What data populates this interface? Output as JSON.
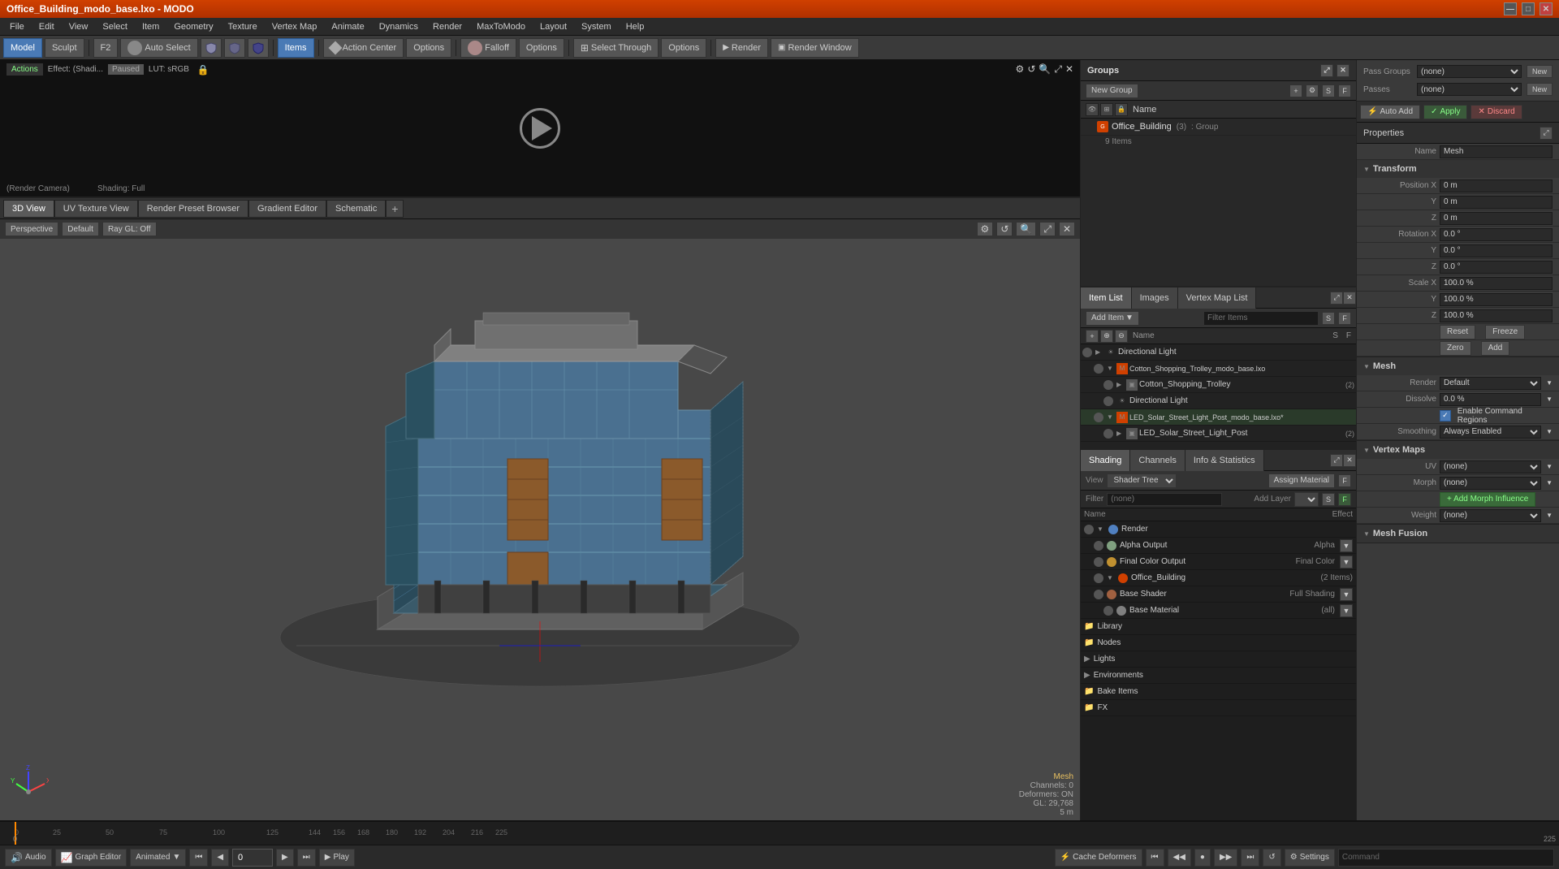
{
  "titleBar": {
    "title": "Office_Building_modo_base.lxo - MODO",
    "controls": [
      "—",
      "□",
      "✕"
    ]
  },
  "menuBar": {
    "items": [
      "File",
      "Edit",
      "View",
      "Select",
      "Item",
      "Geometry",
      "Texture",
      "Vertex Map",
      "Animate",
      "Dynamics",
      "Render",
      "MaxToModo",
      "Layout",
      "System",
      "Help"
    ]
  },
  "toolbar": {
    "modeButtons": [
      "Model",
      "Sculpt"
    ],
    "f2": "F2",
    "autoSelect": "Auto Select",
    "items": "Items",
    "actionCenter": "Action Center",
    "options1": "Options",
    "falloff": "Falloff",
    "options2": "Options",
    "selectThrough": "Select Through",
    "options3": "Options",
    "render": "Render",
    "renderWindow": "Render Window"
  },
  "previewStrip": {
    "label": "Actions",
    "effect": "Effect: (Shadi...",
    "status": "Paused",
    "lut": "LUT: sRGB",
    "camera": "(Render Camera)",
    "shading": "Shading: Full"
  },
  "subTabs": {
    "tabs": [
      "3D View",
      "UV Texture View",
      "Render Preset Browser",
      "Gradient Editor",
      "Schematic"
    ],
    "activeTab": "3D View",
    "addTab": "+"
  },
  "viewport": {
    "perspective": "Perspective",
    "default": "Default",
    "rayGL": "Ray GL: Off",
    "status": {
      "label": "Mesh",
      "channels": "Channels: 0",
      "deformers": "Deformers: ON",
      "gl": "GL: 29,768",
      "scale": "5 m"
    }
  },
  "groupsPanel": {
    "title": "Groups",
    "newGroup": "New Group",
    "columnHeader": "Name",
    "group": {
      "name": "Office_Building",
      "count": "(3)",
      "type": "Group",
      "items": "9 Items"
    }
  },
  "itemPanel": {
    "tabs": [
      "Item List",
      "Images",
      "Vertex Map List"
    ],
    "activeTab": "Item List",
    "addItem": "Add Item",
    "filterItems": "Filter Items",
    "columns": {
      "name": "Name",
      "s": "S",
      "f": "F"
    },
    "items": [
      {
        "name": "Directional Light",
        "indent": 0,
        "type": "light"
      },
      {
        "name": "Cotton_Shopping_Trolley_modo_base.lxo",
        "indent": 1,
        "type": "mesh"
      },
      {
        "name": "Cotton_Shopping_Trolley",
        "indent": 2,
        "type": "mesh",
        "count": "(2)"
      },
      {
        "name": "Directional Light",
        "indent": 2,
        "type": "light"
      },
      {
        "name": "LED_Solar_Street_Light_Post_modo_base.lxo*",
        "indent": 1,
        "type": "mesh"
      },
      {
        "name": "LED_Solar_Street_Light_Post",
        "indent": 2,
        "type": "mesh",
        "count": "(2)"
      }
    ]
  },
  "shadingPanel": {
    "tabs": [
      "Shading",
      "Channels",
      "Info & Statistics"
    ],
    "activeTab": "Shading",
    "view": "Shader Tree",
    "assignMaterial": "Assign Material",
    "filterLabel": "Filter",
    "filterValue": "(none)",
    "addLayer": "Add Layer",
    "items": [
      {
        "name": "Render",
        "indent": 0,
        "type": "render",
        "expand": true
      },
      {
        "name": "Alpha Output",
        "indent": 1,
        "type": "alpha",
        "effect": "Alpha"
      },
      {
        "name": "Final Color Output",
        "indent": 1,
        "type": "final",
        "effect": "Final Color"
      },
      {
        "name": "Office_Building",
        "indent": 1,
        "type": "office",
        "effect": "(2 Items)",
        "expand": true
      },
      {
        "name": "Base Shader",
        "indent": 1,
        "type": "shader",
        "effect": "Full Shading"
      },
      {
        "name": "Base Material",
        "indent": 2,
        "type": "material",
        "effect": "(all)"
      },
      {
        "name": "Library",
        "indent": 1,
        "type": "folder"
      },
      {
        "name": "Nodes",
        "indent": 1,
        "type": "folder"
      },
      {
        "name": "Lights",
        "indent": 0,
        "type": "folder",
        "expand": false
      },
      {
        "name": "Environments",
        "indent": 0,
        "type": "folder",
        "expand": false
      },
      {
        "name": "Bake Items",
        "indent": 0,
        "type": "folder"
      },
      {
        "name": "FX",
        "indent": 0,
        "type": "folder"
      }
    ]
  },
  "propertiesPanel": {
    "title": "Properties",
    "passGroups": {
      "label": "Pass Groups",
      "passGroupsValue": "(none)",
      "newBtn": "New",
      "passesLabel": "Passes",
      "passesValue": "(none)",
      "newBtn2": "New"
    },
    "topButtons": {
      "autoAdd": "Auto Add",
      "apply": "Apply",
      "discard": "Discard"
    },
    "name": {
      "label": "Name",
      "value": "Mesh"
    },
    "transform": {
      "label": "Transform",
      "positionX": "0 m",
      "positionY": "0 m",
      "positionZ": "0 m",
      "rotationX": "0.0 °",
      "rotationY": "0.0 °",
      "rotationZ": "0.0 °",
      "scaleX": "100.0 %",
      "scaleY": "100.0 %",
      "scaleZ": "100.0 %",
      "reset": "Reset",
      "freeze": "Freeze",
      "zero": "Zero",
      "add": "Add"
    },
    "mesh": {
      "label": "Mesh",
      "render": "Default",
      "dissolve": "0.0 %",
      "enableCommandRegions": "Enable Command Regions",
      "smoothing": "Always Enabled"
    },
    "vertexMaps": {
      "label": "Vertex Maps",
      "uvLabel": "UV",
      "uvValue": "(none)",
      "morphLabel": "Morph",
      "morphValue": "(none)",
      "addMorphInfluence": "Add Morph Influence",
      "weightLabel": "Weight",
      "weightValue": "(none)"
    },
    "meshFusion": {
      "label": "Mesh Fusion"
    }
  },
  "bottomBar": {
    "audio": "Audio",
    "graphEditor": "Graph Editor",
    "animated": "Animated",
    "cacheDeformers": "Cache Deformers",
    "settings": "Settings",
    "play": "Play",
    "playBtn": "▶",
    "timeValue": "0"
  },
  "timeline": {
    "ticks": [
      0,
      25,
      50,
      75,
      100,
      125,
      144,
      156,
      168,
      180,
      192,
      204,
      216,
      225
    ],
    "labels": [
      "0",
      "25",
      "50",
      "75",
      "100",
      "125",
      "144",
      "156",
      "168",
      "180",
      "192",
      "204",
      "216",
      "225"
    ]
  }
}
